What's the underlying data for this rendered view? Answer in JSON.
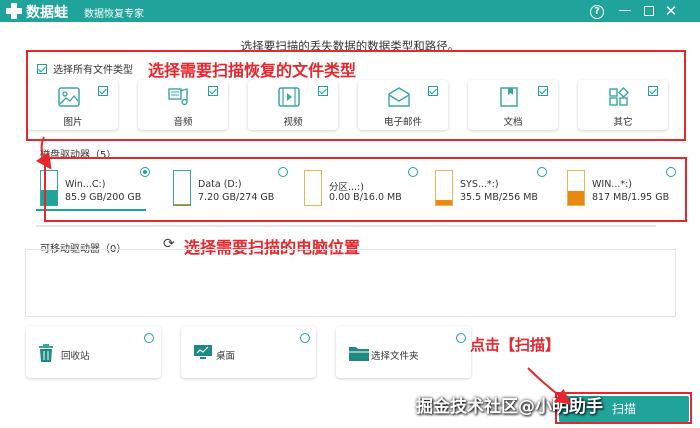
{
  "app": {
    "brand": "数据蛙",
    "subtitle": "数据恢复专家",
    "help": "?",
    "minimize": "—",
    "close": "✕"
  },
  "instruction": "选择要扫描的丢失数据的数据类型和路径。",
  "select_all_label": "选择所有文件类型",
  "file_types": [
    {
      "label": "图片",
      "icon": "image-icon",
      "checked": true
    },
    {
      "label": "音频",
      "icon": "music-icon",
      "checked": true
    },
    {
      "label": "视频",
      "icon": "video-icon",
      "checked": true
    },
    {
      "label": "电子邮件",
      "icon": "mail-icon",
      "checked": true
    },
    {
      "label": "文档",
      "icon": "document-icon",
      "checked": true
    },
    {
      "label": "其它",
      "icon": "other-icon",
      "checked": true
    }
  ],
  "drives_label": "磁盘驱动器（5）",
  "drives": [
    {
      "name": "Win...C:)",
      "size": "85.9 GB/200 GB",
      "used_fraction": 0.43,
      "selected": true
    },
    {
      "name": "Data (D:)",
      "size": "7.20 GB/274 GB",
      "used_fraction": 0.03,
      "selected": false
    },
    {
      "name": "分区...:)",
      "size": "0.00  B/16.0 MB",
      "used_fraction": 0.0,
      "selected": false
    },
    {
      "name": "SYS...*:)",
      "size": "35.5 MB/256 MB",
      "used_fraction": 0.14,
      "selected": false
    },
    {
      "name": "WIN...*:)",
      "size": "817 MB/1.95 GB",
      "used_fraction": 0.41,
      "selected": false
    }
  ],
  "removable_label": "可移动驱动器（0）",
  "locations": [
    {
      "label": "回收站",
      "icon": "trash-icon"
    },
    {
      "label": "桌面",
      "icon": "desktop-icon"
    },
    {
      "label": "选择文件夹",
      "icon": "folder-icon"
    }
  ],
  "scan_button": "扫描",
  "annotations": {
    "a1": "选择需要扫描恢复的文件类型",
    "a2": "选择需要扫描的电脑位置",
    "a3": "点击【扫描】"
  },
  "watermark": "掘金技术社区@小明助手",
  "colors": {
    "accent": "#1fa39a",
    "annotation": "#e8262d",
    "drive_fill": "#e88a12"
  }
}
